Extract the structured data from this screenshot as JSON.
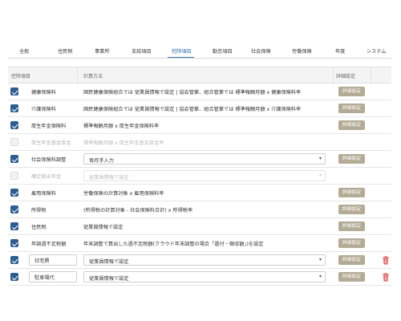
{
  "tabs": [
    {
      "label": "全般",
      "active": false
    },
    {
      "label": "住民税",
      "active": false
    },
    {
      "label": "事業所",
      "active": false
    },
    {
      "label": "支給項目",
      "active": false
    },
    {
      "label": "控除項目",
      "active": true
    },
    {
      "label": "勤怠項目",
      "active": false
    },
    {
      "label": "社会保険",
      "active": false
    },
    {
      "label": "労働保険",
      "active": false
    },
    {
      "label": "年度",
      "active": false
    },
    {
      "label": "システム",
      "active": false
    }
  ],
  "table": {
    "headers": {
      "item": "控除項目",
      "calc": "計算方法",
      "detail": "詳細設定"
    },
    "detail_button_label": "詳細設定",
    "rows": [
      {
        "checked": true,
        "enabled": true,
        "name": "健康保険料",
        "method": "国民健康保険組合では 従業員情報で設定 | 協会管掌、組合管掌では 標準報酬月額 x 健康保険料率",
        "deletable": false
      },
      {
        "checked": true,
        "enabled": true,
        "name": "介護保険料",
        "method": "国民健康保険組合では 従業員情報で設定 | 協会管掌、組合管掌では 標準報酬月額 x 介護保険料率",
        "deletable": false
      },
      {
        "checked": true,
        "enabled": true,
        "name": "厚生年金保険料",
        "method": "標準報酬月額 x 厚生年金保険料率",
        "deletable": false
      },
      {
        "checked": false,
        "enabled": false,
        "name": "厚生年金基金掛金",
        "method": "標準報酬月額 x 厚生年金基金掛金率",
        "deletable": false
      },
      {
        "checked": true,
        "enabled": true,
        "name": "社会保険料調整",
        "select": "毎月手入力",
        "deletable": false
      },
      {
        "checked": false,
        "enabled": false,
        "name": "確定拠出年金",
        "select": "従業員情報で設定",
        "deletable": false
      },
      {
        "checked": true,
        "enabled": true,
        "name": "雇用保険料",
        "method": "労働保険の計算対象 x 雇用保険料率",
        "deletable": false
      },
      {
        "checked": true,
        "enabled": true,
        "name": "所得税",
        "method": "(所得税の計算対象 - 社会保険料合計) x 所得税率",
        "deletable": false
      },
      {
        "checked": true,
        "enabled": true,
        "name": "住民税",
        "method": "従業員情報で設定",
        "deletable": false
      },
      {
        "checked": true,
        "enabled": true,
        "name": "年調過不足税額",
        "method": "年末調整で算出した過不足税額(クラウド年末調整の場合「還付・徴収額」)を設定",
        "deletable": false
      },
      {
        "checked": true,
        "enabled": true,
        "name_input": "社宅費",
        "select": "従業員情報で設定",
        "deletable": true
      },
      {
        "checked": true,
        "enabled": true,
        "name_input": "駐車場代",
        "select": "従業員情報で設定",
        "deletable": true
      }
    ]
  },
  "colors": {
    "accent": "#2f74b8",
    "checkbox": "#2e5d92",
    "detail_button": "#b4ab95",
    "delete_icon": "#e05555"
  },
  "icons": {
    "delete": "trash-icon",
    "dropdown": "chevron-down-icon"
  }
}
